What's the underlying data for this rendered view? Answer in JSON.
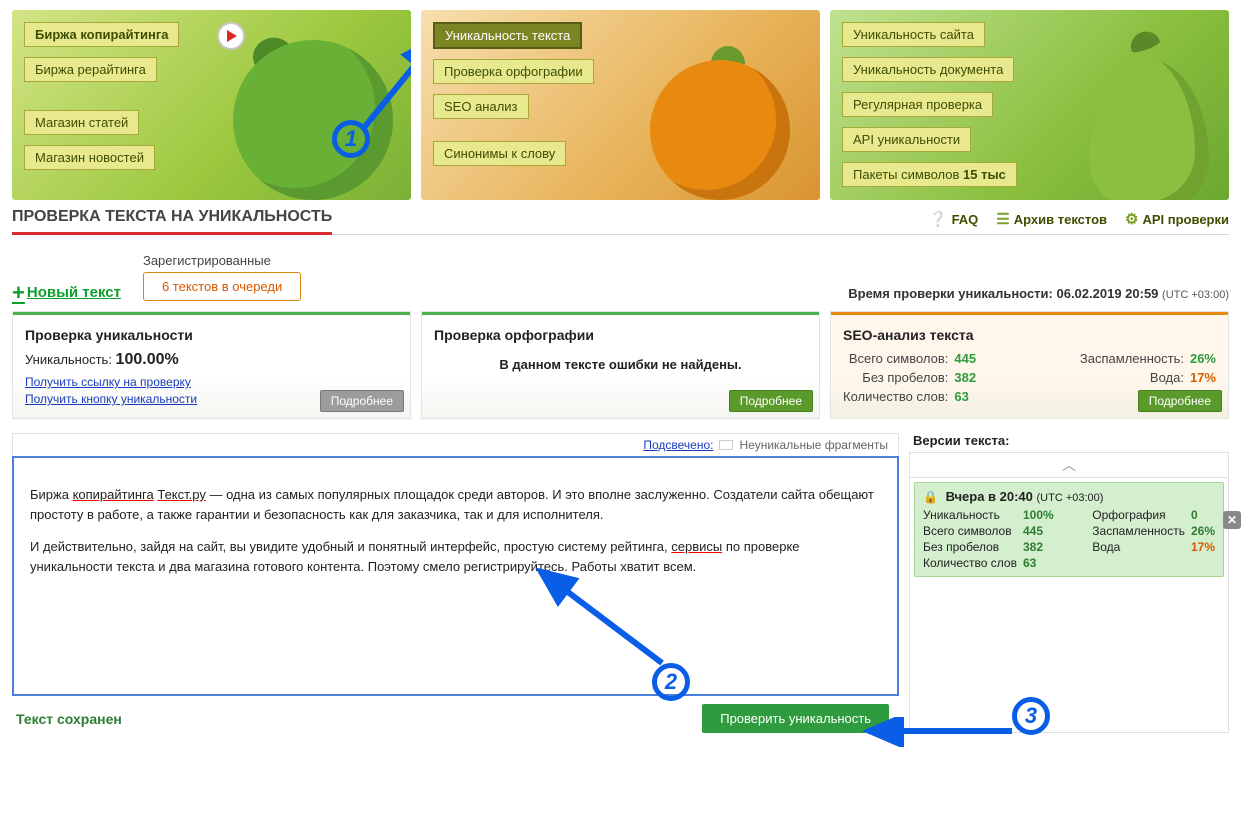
{
  "hero": {
    "apple": {
      "main_bold": "Биржа копирайтинга",
      "rewriting": "Биржа рерайтинга",
      "articles": "Магазин статей",
      "news": "Магазин новостей"
    },
    "orange": {
      "uniq": "Уникальность текста",
      "spell": "Проверка орфографии",
      "seo": "SEO анализ",
      "synonyms": "Синонимы к слову"
    },
    "pear": {
      "site": "Уникальность сайта",
      "doc": "Уникальность документа",
      "reg": "Регулярная проверка",
      "api": "API уникальности",
      "pack_l": "Пакеты символов ",
      "pack_r": "15 тыс"
    }
  },
  "title": "ПРОВЕРКА ТЕКСТА НА УНИКАЛЬНОСТЬ",
  "toplinks": {
    "faq": "FAQ",
    "archive": "Архив текстов",
    "api": "API проверки"
  },
  "sub": {
    "new_text": "Новый текст",
    "registered": "Зарегистрированные",
    "queue": "6 текстов в очереди",
    "time_label": "Время проверки уникальности: ",
    "time_val": "06.02.2019 20:59",
    "tz": "(UTC +03:00)"
  },
  "panels": {
    "uniq": {
      "head": "Проверка уникальности",
      "lbl": "Уникальность: ",
      "val": "100.00%",
      "link1": "Получить ссылку на проверку",
      "link2": "Получить кнопку уникальности",
      "more": "Подробнее"
    },
    "spell": {
      "head": "Проверка орфографии",
      "msg": "В данном тексте ошибки не найдены.",
      "more": "Подробнее"
    },
    "seo": {
      "head": "SEO-анализ текста",
      "rows": {
        "sym_l": "Всего символов:",
        "sym_v": "445",
        "nosp_l": "Без пробелов:",
        "nosp_v": "382",
        "words_l": "Количество слов:",
        "words_v": "63",
        "spam_l": "Заспамленность:",
        "spam_v": "26%",
        "water_l": "Вода:",
        "water_v": "17%"
      },
      "more": "Подробнее"
    }
  },
  "editor": {
    "hl_label": "Подсвечено:",
    "hl_frag": "Неуникальные фрагменты",
    "p1a": "Биржа ",
    "p1b": "копирайтинга",
    "p1c": " ",
    "p1d": "Текст.ру",
    "p1e": " — одна из самых популярных площадок среди авторов. И это вполне заслуженно. Создатели сайта обещают простоту в работе, а также гарантии и безопасность как для заказчика, так и для исполнителя.",
    "p2a": "И действительно, зайдя на сайт, вы увидите удобный и понятный интерфейс, простую систему рейтинга, ",
    "p2b": "сервисы",
    "p2c": " по проверке уникальности текста и два магазина готового контента.  Поэтому смело регистрируйтесь. Работы хватит всем.",
    "saved": "Текст сохранен",
    "check": "Проверить уникальность"
  },
  "versions": {
    "head": "Версии текста:",
    "card": {
      "title_pre": "Вчера в 20:40 ",
      "title_tz": "(UTC +03:00)",
      "uniq_l": "Уникальность",
      "uniq_v": "100%",
      "sym_l": "Всего символов",
      "sym_v": "445",
      "nosp_l": "Без пробелов",
      "nosp_v": "382",
      "words_l": "Количество слов",
      "words_v": "63",
      "orth_l": "Орфография",
      "orth_v": "0",
      "spam_l": "Заспамленность",
      "spam_v": "26%",
      "water_l": "Вода",
      "water_v": "17%"
    }
  }
}
